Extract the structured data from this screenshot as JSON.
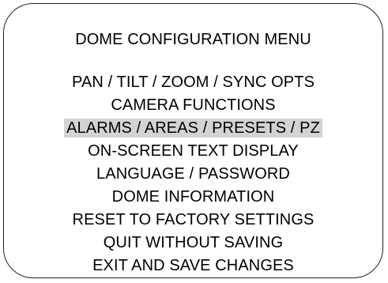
{
  "menu": {
    "title": "DOME CONFIGURATION MENU",
    "selected_index": 2,
    "highlight_color": "#d3d3d3",
    "items": [
      {
        "label": "PAN / TILT / ZOOM / SYNC OPTS"
      },
      {
        "label": "CAMERA FUNCTIONS"
      },
      {
        "label": "ALARMS / AREAS / PRESETS / PZ"
      },
      {
        "label": "ON-SCREEN TEXT DISPLAY"
      },
      {
        "label": "LANGUAGE / PASSWORD"
      },
      {
        "label": "DOME INFORMATION"
      },
      {
        "label": "RESET TO FACTORY SETTINGS"
      },
      {
        "label": "QUIT WITHOUT SAVING"
      },
      {
        "label": "EXIT AND SAVE CHANGES"
      }
    ]
  }
}
